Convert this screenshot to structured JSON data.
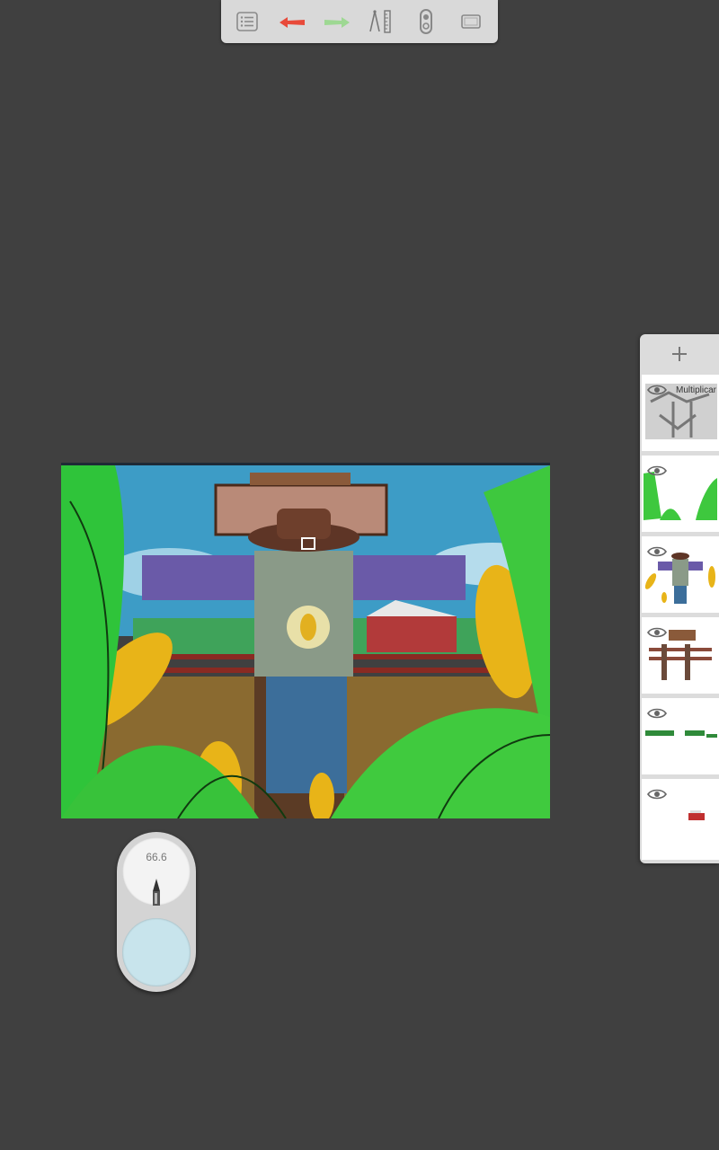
{
  "toolbar": {
    "icons": [
      "list-icon",
      "undo-icon",
      "redo-icon",
      "ruler-compass-icon",
      "symmetry-icon",
      "fullscreen-icon"
    ],
    "colors": {
      "undo": "#e84a3a",
      "redo": "#9ed893"
    }
  },
  "layers": {
    "add_label": "+",
    "items": [
      {
        "id": 1,
        "blend_mode": "Multiplicar"
      },
      {
        "id": 2,
        "blend_mode": ""
      },
      {
        "id": 3,
        "blend_mode": ""
      },
      {
        "id": 4,
        "blend_mode": ""
      },
      {
        "id": 5,
        "blend_mode": ""
      },
      {
        "id": 6,
        "blend_mode": ""
      }
    ]
  },
  "brush": {
    "size": "66.6",
    "color": "#c8e4ec"
  }
}
